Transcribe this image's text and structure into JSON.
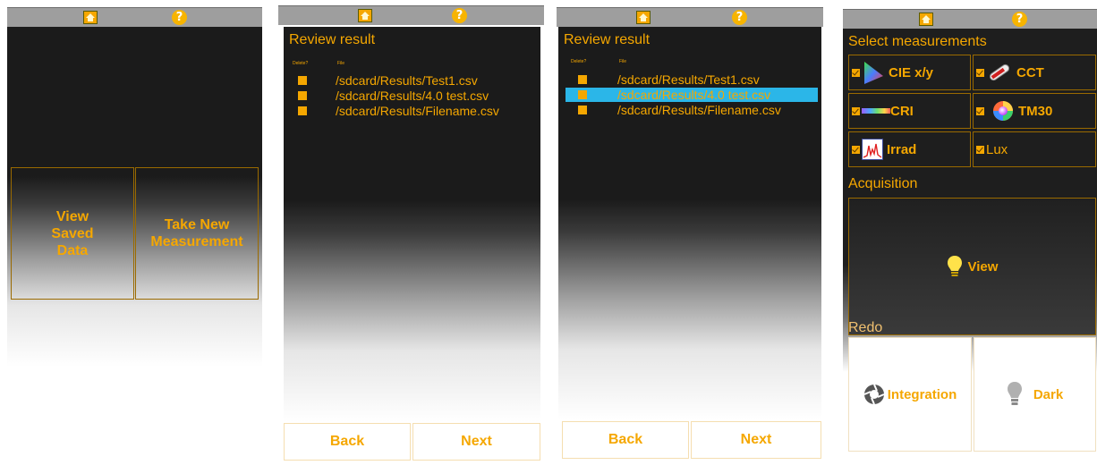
{
  "screen1": {
    "view_saved_label": "View\nSaved\nData",
    "take_new_label": "Take New\nMeasurement"
  },
  "screen2": {
    "title": "Review result",
    "col_delete": "Delete?",
    "col_file": "File",
    "files": [
      "/sdcard/Results/Test1.csv",
      "/sdcard/Results/4.0 test.csv",
      "/sdcard/Results/Filename.csv"
    ],
    "back_label": "Back",
    "next_label": "Next"
  },
  "screen3": {
    "title": "Review result",
    "col_delete": "Delete?",
    "col_file": "File",
    "files": [
      "/sdcard/Results/Test1.csv",
      "/sdcard/Results/4.0 test.csv",
      "/sdcard/Results/Filename.csv"
    ],
    "selected_file": "/sdcard/Results/4.0 test.csv",
    "back_label": "Back",
    "next_label": "Next"
  },
  "screen4": {
    "title": "Select measurements",
    "measurements": [
      "CIE x/y",
      "CCT",
      "CRI",
      "TM30",
      "Irrad",
      "Lux"
    ],
    "acquisition_label": "Acquisition",
    "view_label": "View",
    "redo_label": "Redo",
    "integration_label": "Integration",
    "dark_label": "Dark"
  },
  "colors": {
    "accent": "#f5a700",
    "selection": "#2bb6e8",
    "panel": "#1e1e1e",
    "topbar": "#9e9e9e"
  },
  "icons": [
    "home-icon",
    "help-icon",
    "checkbox-icon",
    "bulb-icon",
    "aperture-icon"
  ]
}
